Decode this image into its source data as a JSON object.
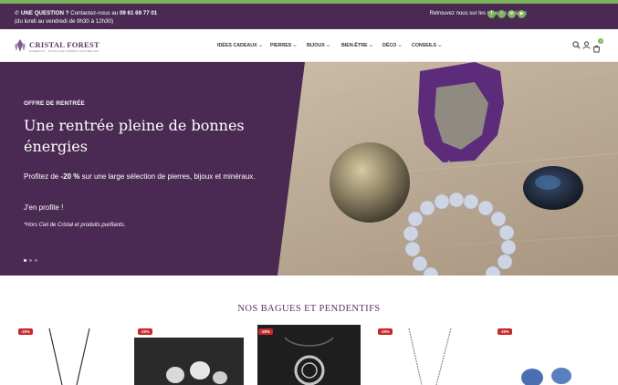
{
  "topbar": {
    "question_label": "UNE QUESTION ?",
    "contact_text": "Contactez-nous au",
    "phone": "09 61 69 77 01",
    "hours": "(du lundi au vendredi de 9h30 à 12h30)",
    "social_text": "Retrouvez nous sur les réseaux sociaux",
    "social_icons": [
      "facebook-icon",
      "instagram-icon",
      "linkedin-icon",
      "youtube-icon"
    ]
  },
  "header": {
    "logo_text": "CRISTAL FOREST",
    "logo_sub": "MINÉRAUX · BIJOUX EN PIERRES NATURELLES",
    "nav": [
      "IDÉES CADEAUX",
      "PIERRES",
      "BIJOUX",
      "BIEN-ÊTRE",
      "DÉCO",
      "CONSEILS"
    ],
    "cart_count": "0",
    "icons": [
      "search-icon",
      "user-icon",
      "cart-icon"
    ]
  },
  "hero": {
    "kicker": "OFFRE DE RENTRÉE",
    "title": "Une rentrée pleine de bonnes énergies",
    "desc_prefix": "Profitez de",
    "desc_bold": "-20 %",
    "desc_suffix": "sur une large sélection de pierres, bijoux et minéraux.",
    "cta": "J'en profite !",
    "note": "*Hors Ciel de Cristal et produits purifiants.",
    "slides": 3,
    "active_slide": 1
  },
  "products_section": {
    "title": "NOS BAGUES ET PENDENTIFS",
    "items": [
      {
        "discount": "-20%"
      },
      {
        "discount": "-20%"
      },
      {
        "discount": "-20%"
      },
      {
        "discount": "-20%"
      },
      {
        "discount": "-20%"
      }
    ]
  },
  "colors": {
    "brand_purple": "#4a2a52",
    "accent_green": "#7cb35a",
    "discount_red": "#c62828"
  }
}
